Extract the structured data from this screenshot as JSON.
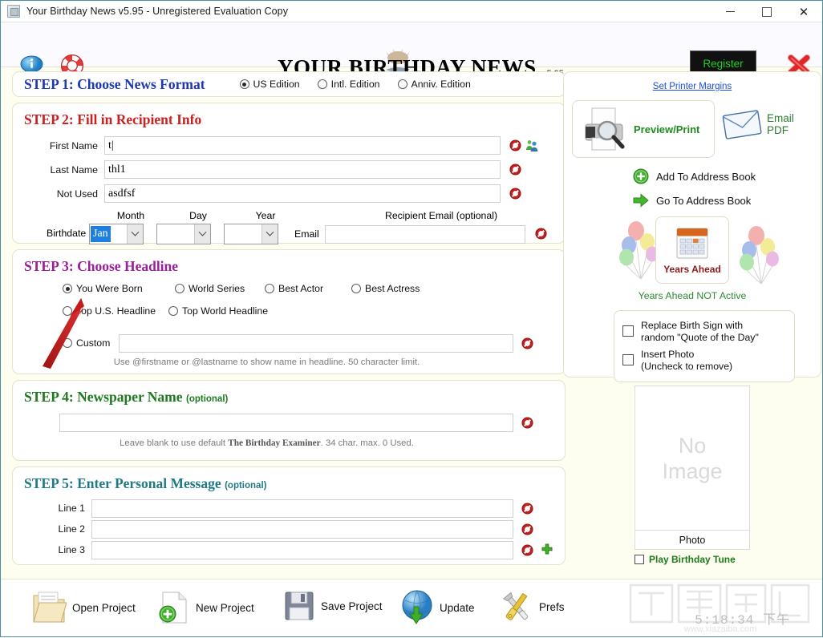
{
  "window": {
    "title": "Your Birthday News v5.95 - Unregistered Evaluation Copy",
    "app_icon": "app-icon",
    "minimize": "—",
    "maximize": "",
    "close": "✕"
  },
  "header": {
    "info_icon": "info-icon",
    "help_icon": "lifebuoy-icon",
    "logo_text": "YOUR BIRTHDAY NEWS",
    "logo_version": "v5.95",
    "register_label": "Register",
    "close_icon": "red-x-close-icon"
  },
  "step1": {
    "heading": "STEP 1: Choose News Format",
    "options": [
      {
        "label": "US Edition",
        "selected": true
      },
      {
        "label": "Intl. Edition",
        "selected": false
      },
      {
        "label": "Anniv. Edition",
        "selected": false
      }
    ]
  },
  "step2": {
    "heading": "STEP 2: Fill in Recipient Info",
    "fields": [
      {
        "label": "First Name",
        "value": "t|"
      },
      {
        "label": "Last Name",
        "value": "thl1"
      },
      {
        "label": "Not Used",
        "value": "asdfsf"
      }
    ],
    "birthdate_label": "Birthdate",
    "month_label": "Month",
    "day_label": "Day",
    "year_label": "Year",
    "month_value": "Jan",
    "day_value": "",
    "year_value": "",
    "email_header": "Recipient Email (optional)",
    "email_label": "Email",
    "email_value": "",
    "clear_icon": "clear-field-icon",
    "address_book_icon": "address-book-people-icon"
  },
  "step3": {
    "heading": "STEP 3: Choose Headline",
    "options": [
      {
        "label": "You Were Born",
        "selected": true
      },
      {
        "label": "World Series",
        "selected": false
      },
      {
        "label": "Best Actor",
        "selected": false
      },
      {
        "label": "Best Actress",
        "selected": false
      },
      {
        "label": "Top U.S. Headline",
        "selected": false
      },
      {
        "label": "Top World Headline",
        "selected": false
      }
    ],
    "custom_label": "Custom",
    "custom_value": "",
    "hint": "Use @firstname or @lastname to show name in headline. 50 character limit."
  },
  "step4": {
    "heading": "STEP 4: Newspaper Name",
    "optional": "(optional)",
    "value": "",
    "hint_pre": "Leave blank to use default ",
    "hint_name": "The Birthday Examiner",
    "hint_post": ". 34 char. max. 0 Used."
  },
  "step5": {
    "heading": "STEP 5: Enter Personal Message",
    "optional": "(optional)",
    "lines": [
      {
        "label": "Line 1",
        "value": ""
      },
      {
        "label": "Line 2",
        "value": ""
      },
      {
        "label": "Line 3",
        "value": ""
      }
    ],
    "add_icon": "add-green-plus-icon"
  },
  "sidebar": {
    "printer_margins_link": "Set Printer Margins",
    "preview_print_label": "Preview/Print",
    "preview_icon": "printer-magnifier-icon",
    "email_pdf_line1": "Email",
    "email_pdf_line2": "PDF",
    "email_icon": "envelope-icon",
    "add_address_book": "Add To Address Book",
    "add_address_icon": "green-plus-circle-icon",
    "go_address_book": "Go To Address Book",
    "go_address_icon": "green-arrow-right-icon",
    "years_ahead_label": "Years Ahead",
    "years_ahead_icon": "calendar-icon",
    "balloons_icon": "balloons-icon",
    "years_ahead_note": "Years Ahead NOT Active",
    "checkboxes": [
      {
        "line1": "Replace Birth Sign with",
        "line2": "random \"Quote of the Day\"",
        "checked": false
      },
      {
        "line1": "Insert Photo",
        "line2": "(Uncheck to remove)",
        "checked": false
      }
    ],
    "photo_placeholder_line1": "No",
    "photo_placeholder_line2": "Image",
    "photo_caption": "Photo",
    "play_tune_label": "Play Birthday Tune",
    "play_tune_checked": false
  },
  "toolbar": {
    "items": [
      {
        "label": "Open Project",
        "icon": "open-folder-icon"
      },
      {
        "label": "New Project",
        "icon": "new-document-icon"
      },
      {
        "label": "Save Project",
        "icon": "floppy-disk-icon"
      },
      {
        "label": "Update",
        "icon": "globe-download-icon"
      },
      {
        "label": "Prefs",
        "icon": "tools-wrench-screwdriver-icon"
      }
    ],
    "clock": "5:18:34 下午"
  },
  "annotation": {
    "arrow_icon": "red-annotation-arrow"
  },
  "colors": {
    "step1": "#1d37b5",
    "step2": "#cc2020",
    "step3": "#9a1f9a",
    "step4": "#1e7a1e",
    "step5": "#1f7a85",
    "register_text": "#22cc22",
    "background": "#fdfdf0"
  }
}
